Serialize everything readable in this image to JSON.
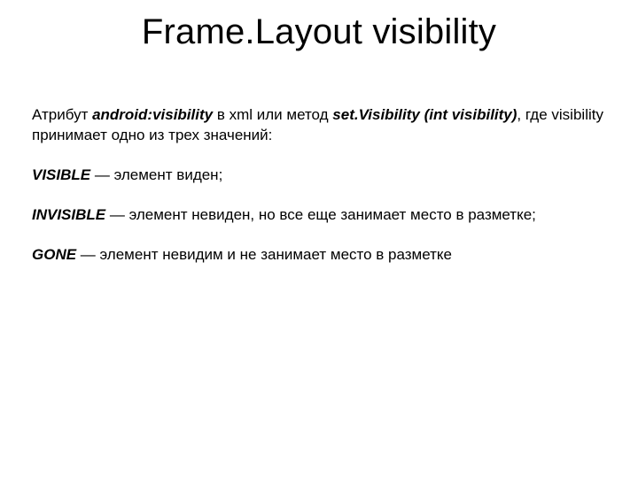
{
  "title": "Frame.Layout visibility",
  "intro": {
    "pre": "Атрибут ",
    "attr": "android:visibility",
    "mid": " в xml или метод ",
    "method": "set.Visibility (int visibility)",
    "post": ", где visibility принимает одно из трех значений:"
  },
  "items": [
    {
      "name": "VISIBLE",
      "desc": " — элемент виден;"
    },
    {
      "name": "INVISIBLE",
      "desc": " — элемент невиден, но все еще занимает место в разметке;"
    },
    {
      "name": "GONE",
      "desc": " — элемент невидим и не занимает место в разметке"
    }
  ]
}
